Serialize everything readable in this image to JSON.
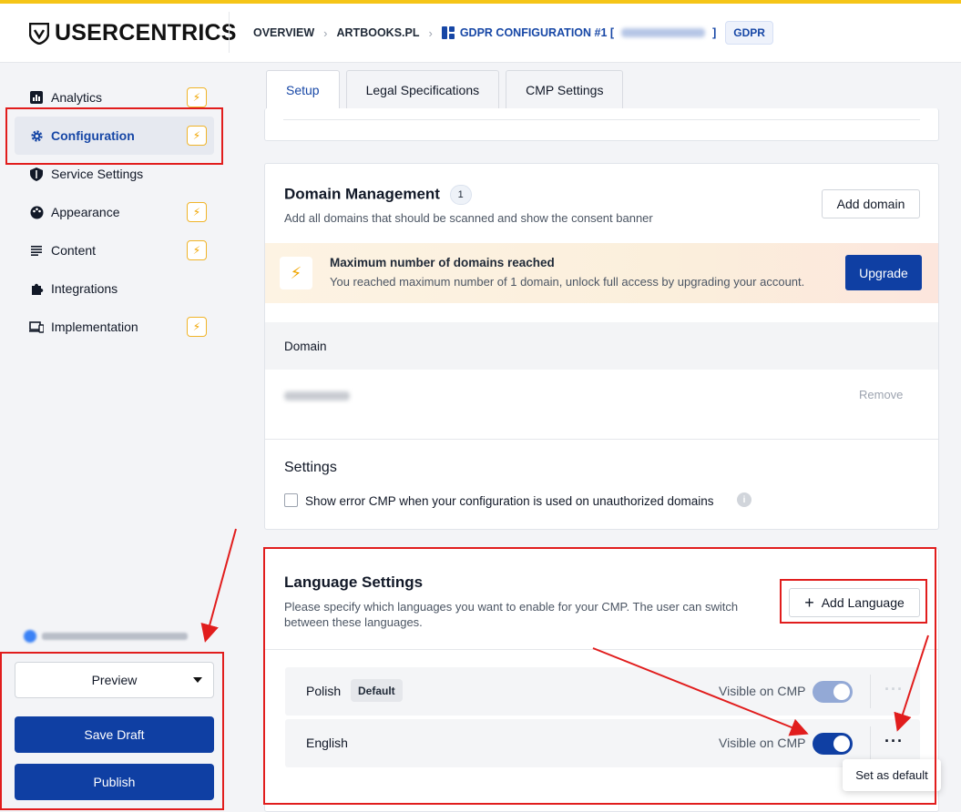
{
  "header": {
    "logo_text": "USERCENTRICS",
    "breadcrumbs": [
      "OVERVIEW",
      "ARTBOOKS.PL",
      "GDPR CONFIGURATION #1 ["
    ],
    "breadcrumb_suffix": "]",
    "badge": "GDPR"
  },
  "sidebar": {
    "items": [
      {
        "label": "Analytics",
        "icon": "bar-chart-icon",
        "upgrade": true
      },
      {
        "label": "Configuration",
        "icon": "gear-icon",
        "upgrade": true,
        "active": true
      },
      {
        "label": "Service Settings",
        "icon": "shield-icon",
        "upgrade": false
      },
      {
        "label": "Appearance",
        "icon": "palette-icon",
        "upgrade": true
      },
      {
        "label": "Content",
        "icon": "lines-icon",
        "upgrade": true
      },
      {
        "label": "Integrations",
        "icon": "puzzle-icon",
        "upgrade": false
      },
      {
        "label": "Implementation",
        "icon": "devices-icon",
        "upgrade": true
      }
    ],
    "preview_label": "Preview",
    "save_draft_label": "Save Draft",
    "publish_label": "Publish"
  },
  "tabs": [
    "Setup",
    "Legal Specifications",
    "CMP Settings"
  ],
  "domain_management": {
    "title": "Domain Management",
    "count": "1",
    "description": "Add all domains that should be scanned and show the consent banner",
    "add_button": "Add domain",
    "warning_title": "Maximum number of domains reached",
    "warning_desc": "You reached maximum number of 1 domain, unlock full access by upgrading your account.",
    "upgrade_button": "Upgrade",
    "table_header": "Domain",
    "remove_label": "Remove",
    "settings_title": "Settings",
    "checkbox_label": "Show error CMP when your configuration is used on unauthorized domains"
  },
  "language_settings": {
    "title": "Language Settings",
    "description": "Please specify which languages you want to enable for your CMP. The user can switch between these languages.",
    "add_button": "Add Language",
    "languages": [
      {
        "name": "Polish",
        "badge": "Default",
        "visible_label": "Visible on CMP",
        "visible": true
      },
      {
        "name": "English",
        "badge": "",
        "visible_label": "Visible on CMP",
        "visible": true
      }
    ],
    "tooltip": "Set as default"
  },
  "colors": {
    "primary": "#0f3fa3",
    "accent_bar": "#f5c518",
    "annotation": "#e11d1d"
  }
}
